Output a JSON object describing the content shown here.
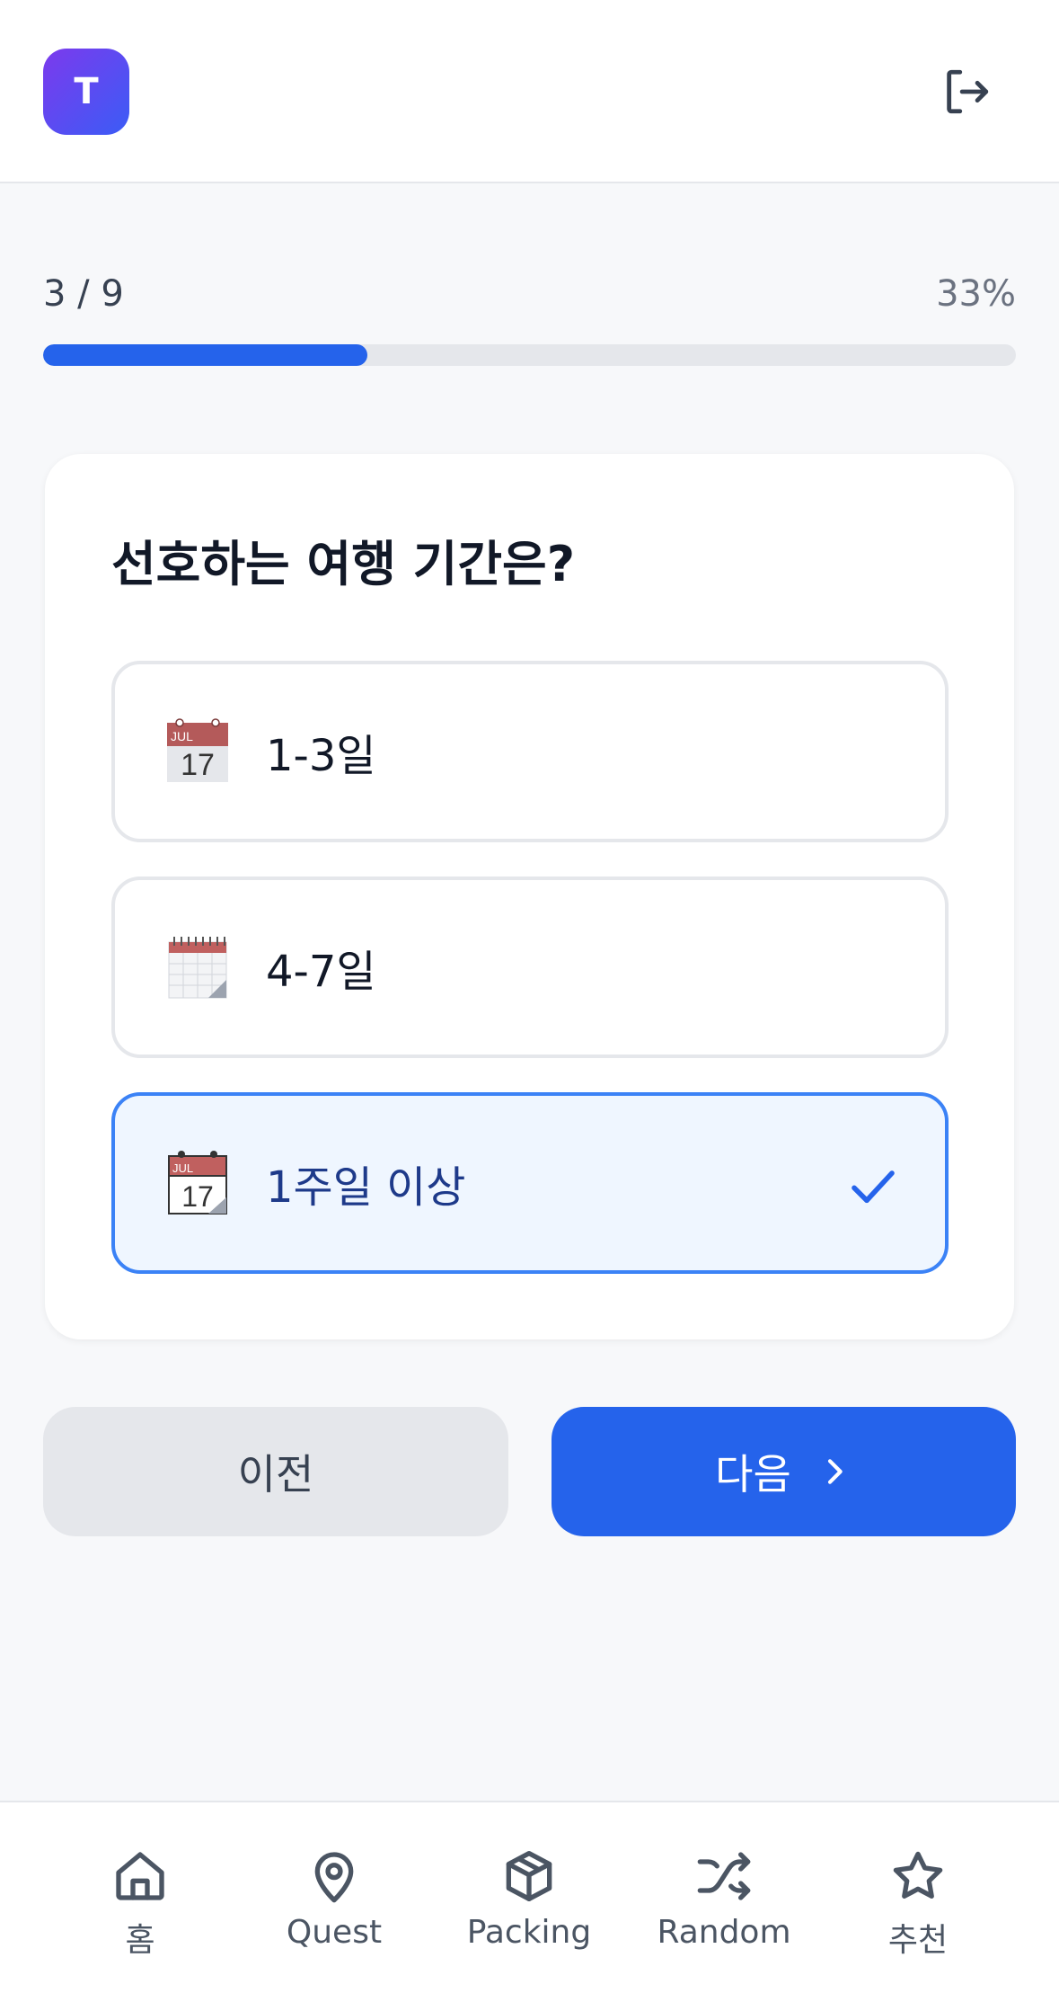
{
  "header": {
    "avatar_letter": "T",
    "logout_icon": "logout-icon"
  },
  "progress": {
    "count": "3 / 9",
    "percent_label": "33%",
    "fraction": 0.333
  },
  "question": {
    "title": "선호하는 여행 기간은?",
    "options": [
      {
        "icon": "calendar-icon",
        "label": "1-3일",
        "selected": false
      },
      {
        "icon": "spiral-calendar-icon",
        "label": "4-7일",
        "selected": false
      },
      {
        "icon": "tear-off-calendar-icon",
        "label": "1주일 이상",
        "selected": true
      }
    ]
  },
  "buttons": {
    "prev_label": "이전",
    "next_label": "다음"
  },
  "nav": {
    "items": [
      {
        "icon": "home-icon",
        "label": "홈"
      },
      {
        "icon": "map-pin-icon",
        "label": "Quest"
      },
      {
        "icon": "package-icon",
        "label": "Packing"
      },
      {
        "icon": "shuffle-icon",
        "label": "Random"
      },
      {
        "icon": "star-icon",
        "label": "추천"
      }
    ]
  },
  "colors": {
    "accent": "#2563eb",
    "selected_border": "#3b82f6",
    "selected_bg": "#eff6ff"
  }
}
